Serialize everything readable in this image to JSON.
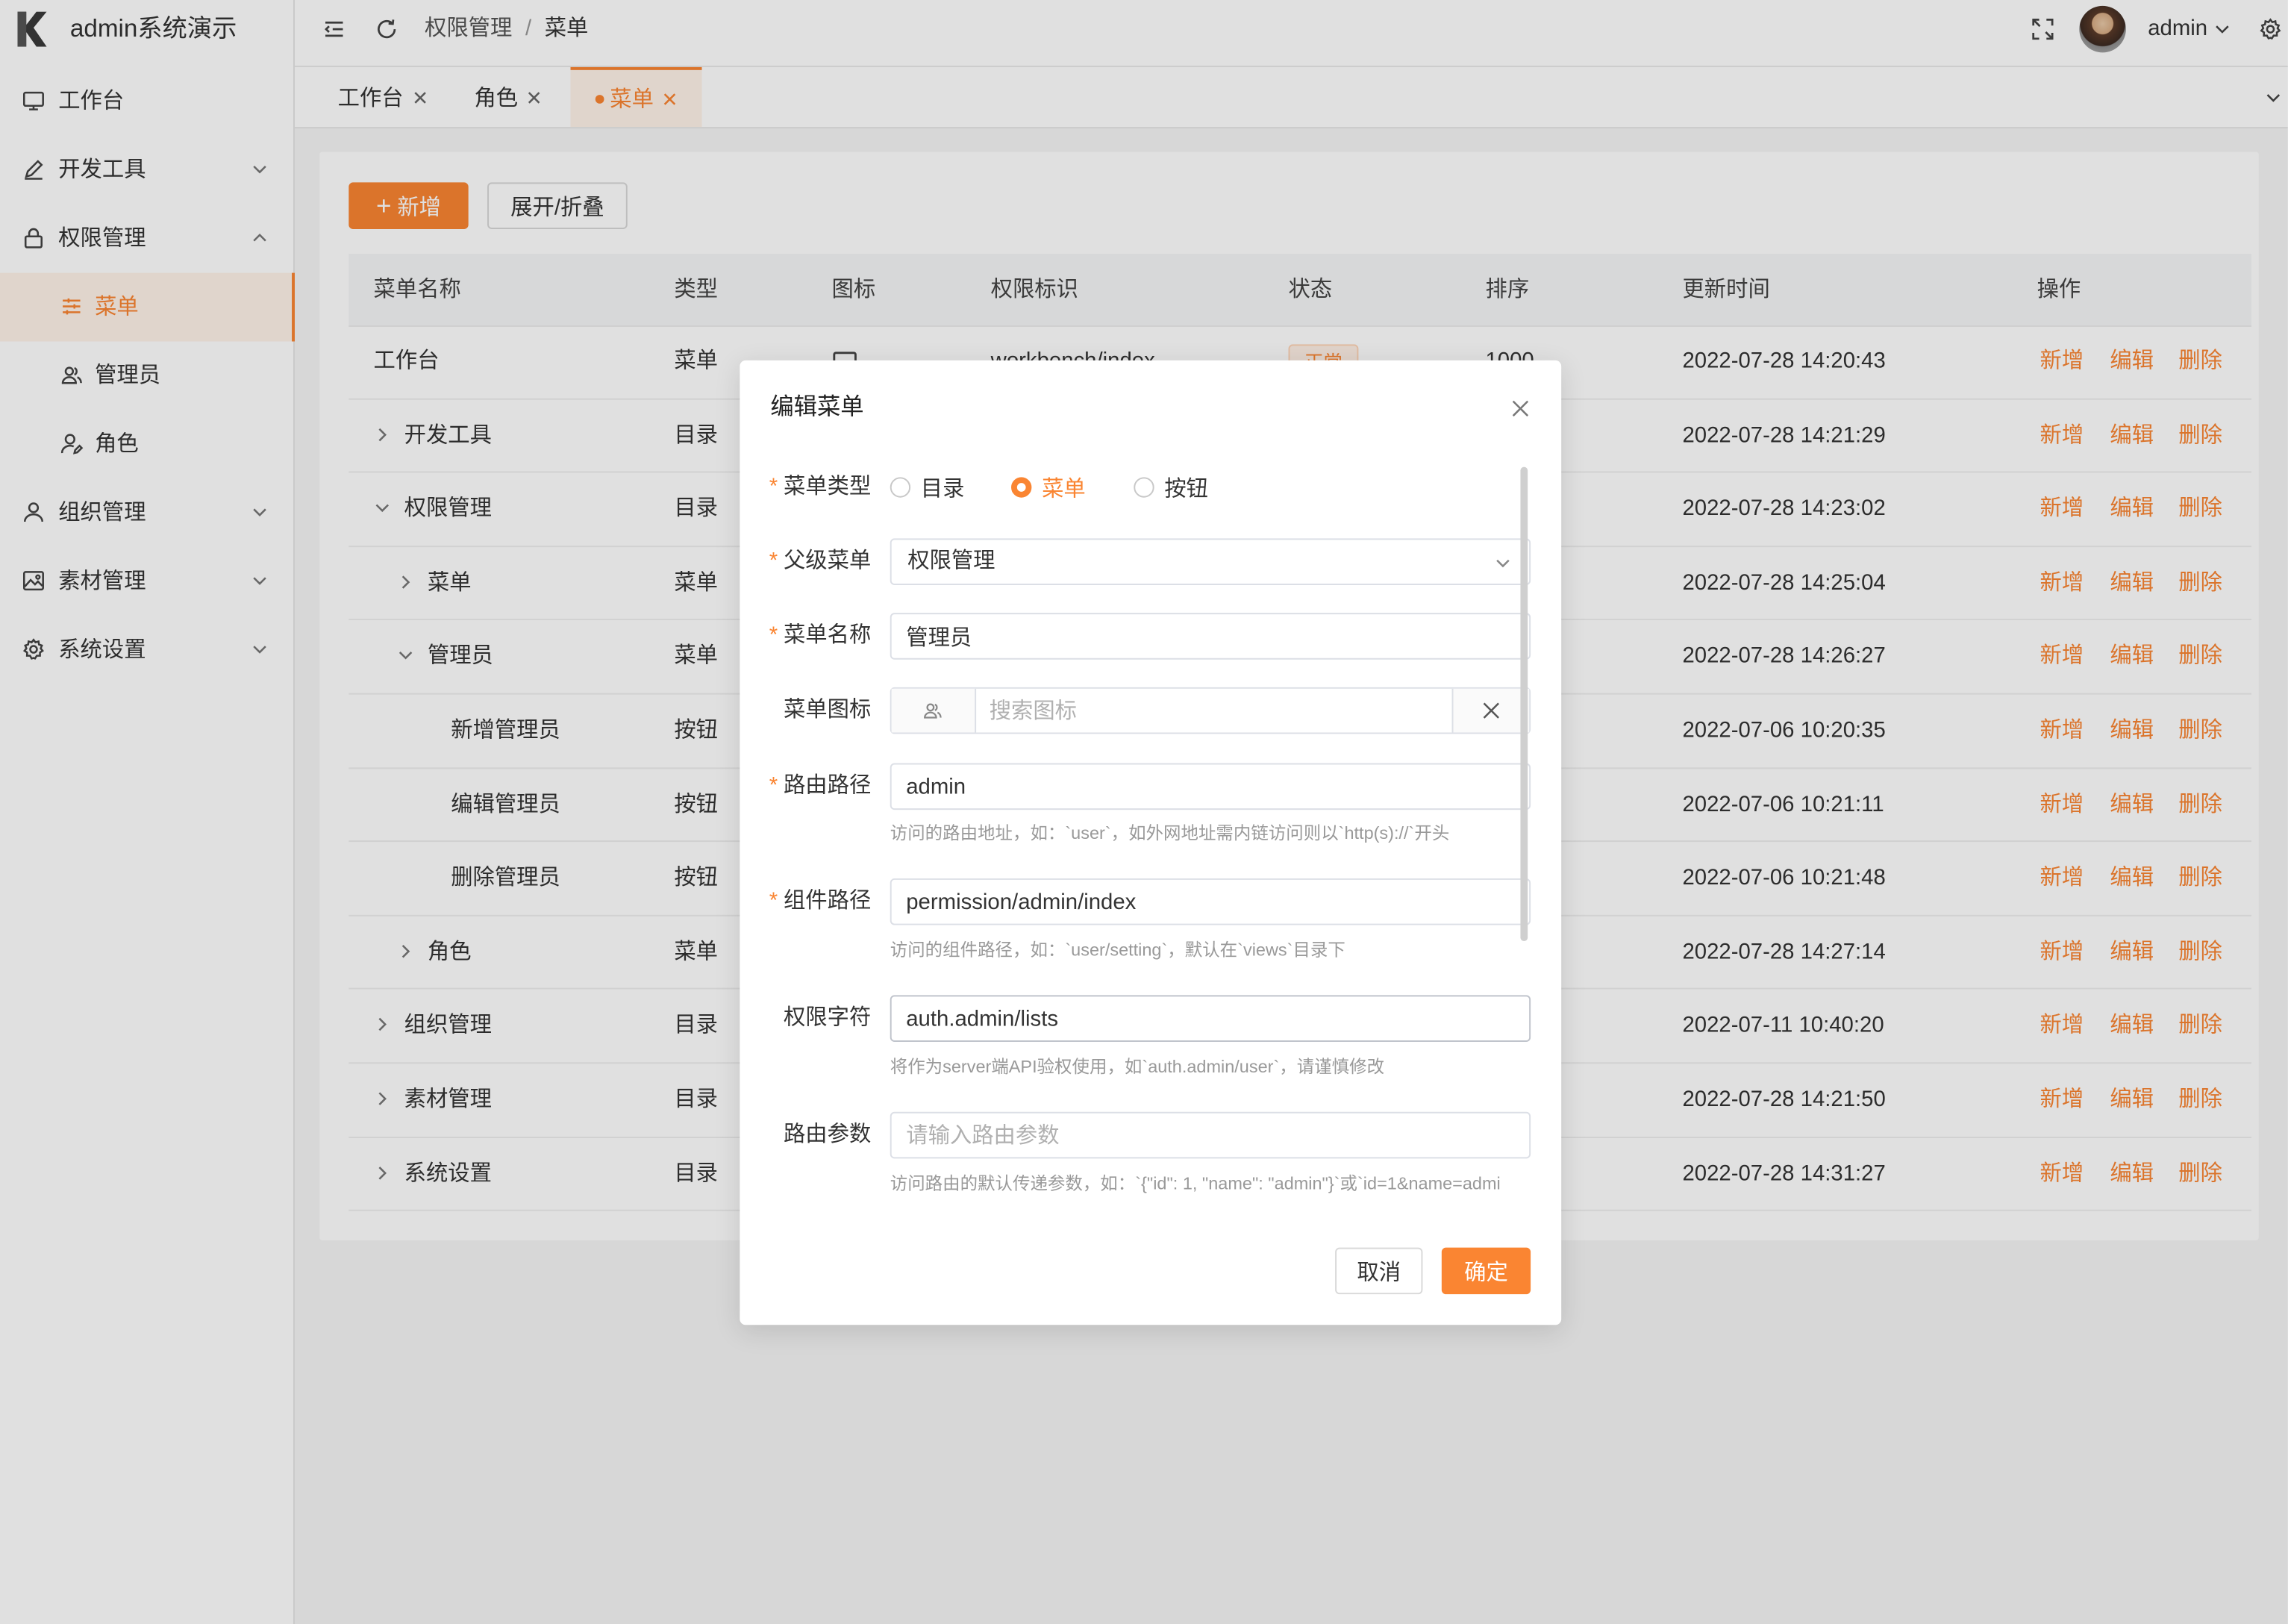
{
  "app": {
    "title": "admin系统演示",
    "logo_icon": "k-logo-icon"
  },
  "colors": {
    "accent": "#fa8532"
  },
  "sidebar": {
    "items": [
      {
        "label": "工作台",
        "icon": "monitor-icon"
      },
      {
        "label": "开发工具",
        "icon": "pen-icon",
        "expandable": true,
        "expanded": false
      },
      {
        "label": "权限管理",
        "icon": "lock-icon",
        "expandable": true,
        "expanded": true
      },
      {
        "label": "菜单",
        "icon": "sliders-icon",
        "active": true
      },
      {
        "label": "管理员",
        "icon": "users-icon"
      },
      {
        "label": "角色",
        "icon": "user-edit-icon"
      },
      {
        "label": "组织管理",
        "icon": "user-icon",
        "expandable": true,
        "expanded": false
      },
      {
        "label": "素材管理",
        "icon": "image-icon",
        "expandable": true,
        "expanded": false
      },
      {
        "label": "系统设置",
        "icon": "gear-icon",
        "expandable": true,
        "expanded": false
      }
    ]
  },
  "header": {
    "breadcrumb": [
      "权限管理",
      "菜单"
    ],
    "separator": "/",
    "username": "admin"
  },
  "tabs": [
    {
      "label": "工作台"
    },
    {
      "label": "角色"
    },
    {
      "label": "菜单",
      "active": true
    }
  ],
  "toolbar": {
    "add_label": "新增",
    "add_icon": "+",
    "toggle_label": "展开/折叠"
  },
  "table": {
    "columns": [
      "菜单名称",
      "类型",
      "图标",
      "权限标识",
      "状态",
      "排序",
      "更新时间",
      "操作"
    ],
    "row_actions": [
      "新增",
      "编辑",
      "删除"
    ],
    "rows": [
      {
        "name": "工作台",
        "level": 0,
        "expandable": false,
        "type": "菜单",
        "icon": "monitor-icon",
        "perm": "workbench/index",
        "status": "正常",
        "sort": "1000",
        "updated": "2022-07-28 14:20:43"
      },
      {
        "name": "开发工具",
        "level": 0,
        "expandable": true,
        "expanded": false,
        "type": "目录",
        "updated": "2022-07-28 14:21:29"
      },
      {
        "name": "权限管理",
        "level": 0,
        "expandable": true,
        "expanded": true,
        "type": "目录",
        "updated": "2022-07-28 14:23:02"
      },
      {
        "name": "菜单",
        "level": 1,
        "expandable": true,
        "expanded": false,
        "type": "菜单",
        "updated": "2022-07-28 14:25:04"
      },
      {
        "name": "管理员",
        "level": 1,
        "expandable": true,
        "expanded": true,
        "type": "菜单",
        "updated": "2022-07-28 14:26:27"
      },
      {
        "name": "新增管理员",
        "level": 2,
        "expandable": false,
        "type": "按钮",
        "updated": "2022-07-06 10:20:35"
      },
      {
        "name": "编辑管理员",
        "level": 2,
        "expandable": false,
        "type": "按钮",
        "updated": "2022-07-06 10:21:11"
      },
      {
        "name": "删除管理员",
        "level": 2,
        "expandable": false,
        "type": "按钮",
        "updated": "2022-07-06 10:21:48"
      },
      {
        "name": "角色",
        "level": 1,
        "expandable": true,
        "expanded": false,
        "type": "菜单",
        "updated": "2022-07-28 14:27:14"
      },
      {
        "name": "组织管理",
        "level": 0,
        "expandable": true,
        "expanded": false,
        "type": "目录",
        "updated": "2022-07-11 10:40:20"
      },
      {
        "name": "素材管理",
        "level": 0,
        "expandable": true,
        "expanded": false,
        "type": "目录",
        "updated": "2022-07-28 14:21:50"
      },
      {
        "name": "系统设置",
        "level": 0,
        "expandable": true,
        "expanded": false,
        "type": "目录",
        "updated": "2022-07-28 14:31:27"
      }
    ]
  },
  "modal": {
    "title": "编辑菜单",
    "required_mark": "*",
    "fields": {
      "type": {
        "label": "菜单类型",
        "required": true,
        "options": [
          "目录",
          "菜单",
          "按钮"
        ],
        "selected": "菜单"
      },
      "parent": {
        "label": "父级菜单",
        "required": true,
        "value": "权限管理"
      },
      "name": {
        "label": "菜单名称",
        "required": true,
        "value": "管理员"
      },
      "icon": {
        "label": "菜单图标",
        "required": false,
        "selected_icon": "users-icon",
        "placeholder": "搜索图标"
      },
      "route": {
        "label": "路由路径",
        "required": true,
        "value": "admin",
        "hint": "访问的路由地址，如：`user`，如外网地址需内链访问则以`http(s)://`开头"
      },
      "component": {
        "label": "组件路径",
        "required": true,
        "value": "permission/admin/index",
        "hint": "访问的组件路径，如：`user/setting`，默认在`views`目录下"
      },
      "perms": {
        "label": "权限字符",
        "required": false,
        "value": "auth.admin/lists",
        "hint": "将作为server端API验权使用，如`auth.admin/user`，请谨慎修改"
      },
      "params": {
        "label": "路由参数",
        "required": false,
        "value": "",
        "placeholder": "请输入路由参数",
        "hint": "访问路由的默认传递参数，如：`{\"id\": 1, \"name\": \"admin\"}`或`id=1&name=admi"
      }
    },
    "cancel_label": "取消",
    "confirm_label": "确定"
  }
}
